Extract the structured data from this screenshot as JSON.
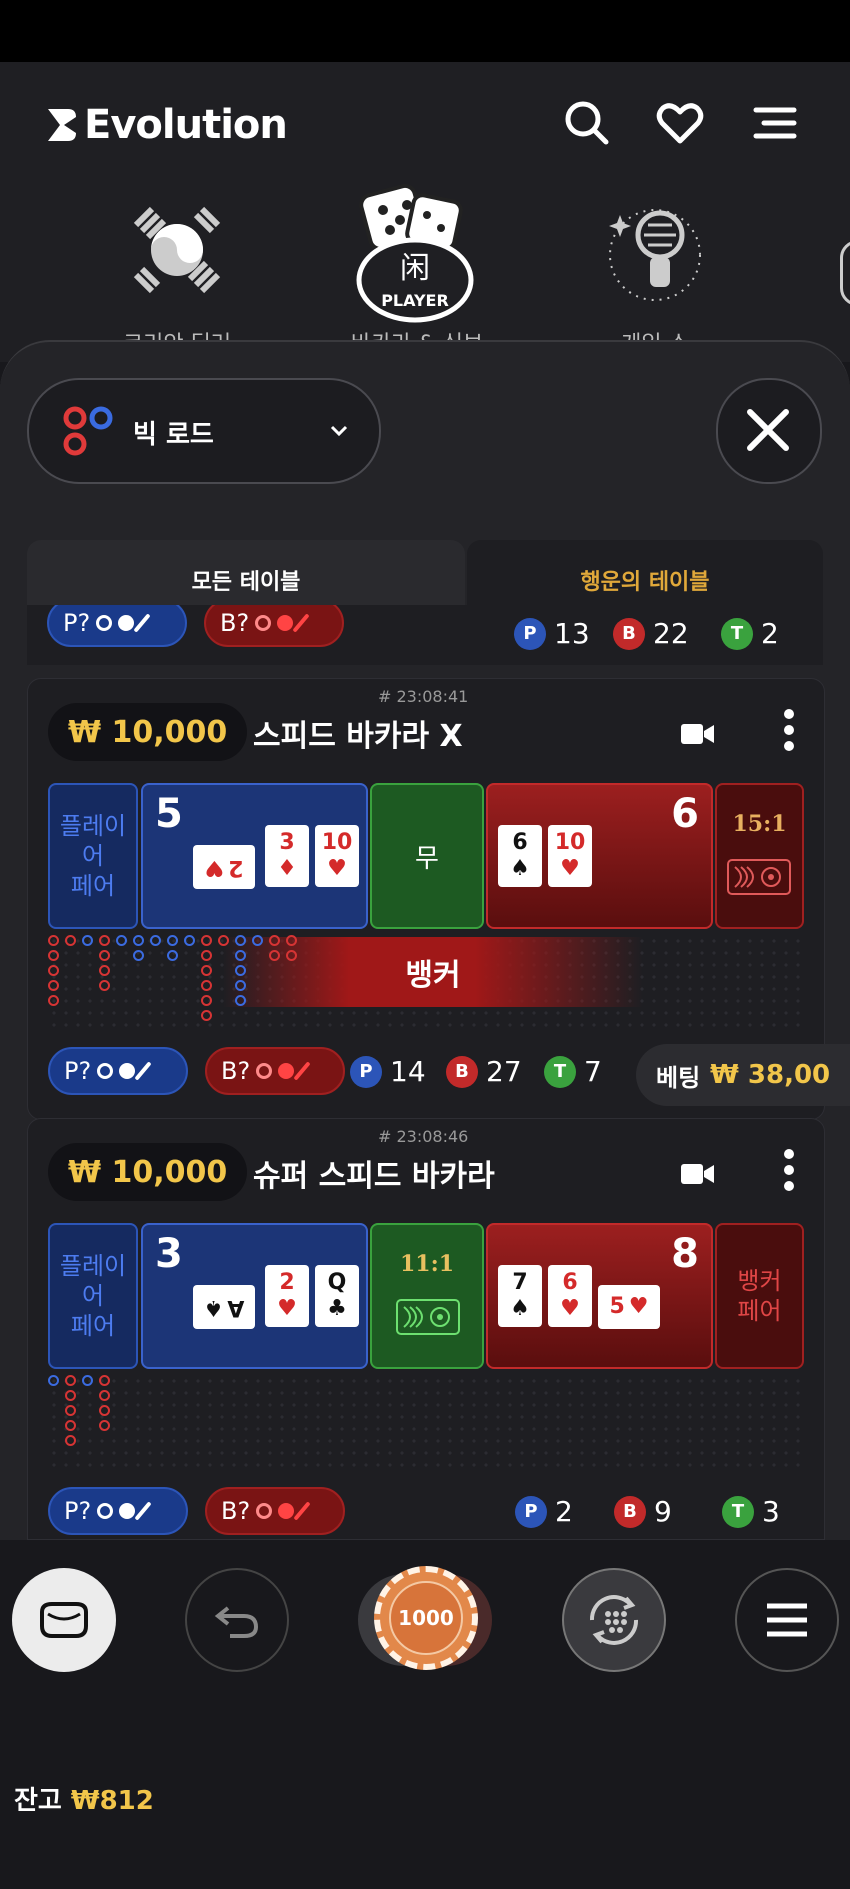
{
  "brand": {
    "name": "Evolution"
  },
  "header_icons": [
    "search-icon",
    "heart-icon",
    "menu-icon"
  ],
  "categories": [
    {
      "icon": "korea-flag-icon",
      "label": "코리안 딜러"
    },
    {
      "icon": "player-dice-icon",
      "label": "바카라 & 식보",
      "badge": "PLAYER",
      "glyph": "闲"
    },
    {
      "icon": "microphone-icon",
      "label": "게임 쇼"
    }
  ],
  "road_selector": {
    "label": "빅 로드"
  },
  "tabs": {
    "all": "모든 테이블",
    "lucky": "행운의 테이블"
  },
  "top_partial": {
    "p": "P?",
    "b": "B?",
    "stats": {
      "p": "13",
      "b": "22",
      "t": "2"
    }
  },
  "tables": [
    {
      "time": "# 23:08:41",
      "min_bet": "₩ 10,000",
      "name": "스피드 바카라 X",
      "left_side": "플레이어\n페어",
      "player_score": "5",
      "player_cards": [
        {
          "rank": "2",
          "suit": "♥",
          "color": "red"
        },
        {
          "rank": "3",
          "suit": "♦",
          "color": "red"
        },
        {
          "rank": "10",
          "suit": "♥",
          "color": "red"
        }
      ],
      "tie": "무",
      "banker_score": "6",
      "banker_cards": [
        {
          "rank": "6",
          "suit": "♠",
          "color": "black"
        },
        {
          "rank": "10",
          "suit": "♥",
          "color": "red"
        }
      ],
      "right_side": "15:1",
      "banner": "뱅커",
      "stats": {
        "p": "14",
        "b": "27",
        "t": "7"
      },
      "bet": {
        "label": "베팅",
        "amount": "₩ 38,00"
      }
    },
    {
      "time": "# 23:08:46",
      "min_bet": "₩ 10,000",
      "name": "슈퍼 스피드 바카라",
      "left_side": "플레이어\n페어",
      "player_score": "3",
      "player_cards": [
        {
          "rank": "A",
          "suit": "♠",
          "color": "black"
        },
        {
          "rank": "2",
          "suit": "♥",
          "color": "red"
        },
        {
          "rank": "Q",
          "suit": "♣",
          "color": "black"
        }
      ],
      "tie": "11:1",
      "banker_score": "8",
      "banker_cards": [
        {
          "rank": "7",
          "suit": "♠",
          "color": "black"
        },
        {
          "rank": "6",
          "suit": "♥",
          "color": "red"
        },
        {
          "rank": "5",
          "suit": "♥",
          "color": "red"
        }
      ],
      "right_side": "뱅커\n페어",
      "stats": {
        "p": "2",
        "b": "9",
        "t": "3"
      }
    }
  ],
  "controls": {
    "chip_value": "1000"
  },
  "balance": {
    "label": "잔고",
    "amount": "₩812"
  },
  "colors": {
    "gold": "#f2c64a",
    "player_blue": "#2c55b8",
    "banker_red": "#c22a2a",
    "tie_green": "#3aa23e"
  }
}
